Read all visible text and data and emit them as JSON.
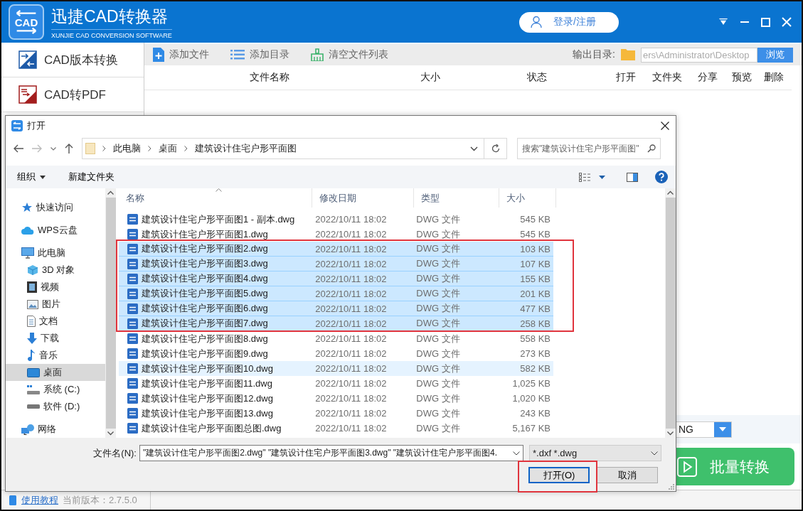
{
  "app": {
    "logo_text": "CAD",
    "title": "迅捷CAD转换器",
    "subtitle": "XUNJIE CAD CONVERSION SOFTWARE",
    "login": "登录/注册"
  },
  "sidebar": {
    "items": [
      {
        "label": "CAD版本转换",
        "kind": "version"
      },
      {
        "label": "CAD转PDF",
        "kind": "pdf"
      }
    ]
  },
  "toolbar": {
    "buttons": [
      {
        "label": "添加文件",
        "kind": "add-file"
      },
      {
        "label": "添加目录",
        "kind": "add-folder"
      },
      {
        "label": "清空文件列表",
        "kind": "clear"
      }
    ],
    "output_label": "输出目录:",
    "output_path": "ers\\Administrator\\Desktop",
    "browse": "浏览"
  },
  "table": {
    "columns": [
      "文件名称",
      "大小",
      "状态",
      "打开",
      "文件夹",
      "分享",
      "预览",
      "删除"
    ]
  },
  "format_select": {
    "value": "NG"
  },
  "convert_button": "批量转换",
  "status_bar": {
    "help_link": "使用教程",
    "version": "当前版本：2.7.5.0"
  },
  "dialog": {
    "title": "打开",
    "breadcrumb": [
      "此电脑",
      "桌面",
      "建筑设计住宅户形平面图"
    ],
    "search": {
      "placeholder": "搜索\"建筑设计住宅户形平面图\""
    },
    "commands": [
      "组织",
      "新建文件夹"
    ],
    "nav": [
      {
        "label": "快速访问",
        "kind": "star",
        "selected": false
      },
      {
        "label": "WPS云盘",
        "kind": "cloud",
        "selected": false
      },
      {
        "label": "此电脑",
        "kind": "pc",
        "selected": false,
        "children": [
          {
            "label": "3D 对象",
            "kind": "cube",
            "selected": false
          },
          {
            "label": "视频",
            "kind": "film",
            "selected": false
          },
          {
            "label": "图片",
            "kind": "image",
            "selected": false
          },
          {
            "label": "文档",
            "kind": "doc",
            "selected": false
          },
          {
            "label": "下载",
            "kind": "download",
            "selected": false
          },
          {
            "label": "音乐",
            "kind": "music",
            "selected": false
          },
          {
            "label": "桌面",
            "kind": "desktop",
            "selected": true
          },
          {
            "label": "系统 (C:)",
            "kind": "system-drive",
            "selected": false
          },
          {
            "label": "软件 (D:)",
            "kind": "drive",
            "selected": false
          }
        ]
      },
      {
        "label": "网络",
        "kind": "network",
        "selected": false
      }
    ],
    "columns": [
      "名称",
      "修改日期",
      "类型",
      "大小"
    ],
    "rows": [
      {
        "name": "建筑设计住宅户形平面图1 - 副本.dwg",
        "date": "2022/10/11 18:02",
        "type": "DWG 文件",
        "size": "545 KB",
        "selected": false,
        "hovered": false
      },
      {
        "name": "建筑设计住宅户形平面图1.dwg",
        "date": "2022/10/11 18:02",
        "type": "DWG 文件",
        "size": "545 KB",
        "selected": false,
        "hovered": false
      },
      {
        "name": "建筑设计住宅户形平面图2.dwg",
        "date": "2022/10/11 18:02",
        "type": "DWG 文件",
        "size": "103 KB",
        "selected": true,
        "hovered": false
      },
      {
        "name": "建筑设计住宅户形平面图3.dwg",
        "date": "2022/10/11 18:02",
        "type": "DWG 文件",
        "size": "107 KB",
        "selected": true,
        "hovered": false
      },
      {
        "name": "建筑设计住宅户形平面图4.dwg",
        "date": "2022/10/11 18:02",
        "type": "DWG 文件",
        "size": "155 KB",
        "selected": true,
        "hovered": false
      },
      {
        "name": "建筑设计住宅户形平面图5.dwg",
        "date": "2022/10/11 18:02",
        "type": "DWG 文件",
        "size": "201 KB",
        "selected": true,
        "hovered": false
      },
      {
        "name": "建筑设计住宅户形平面图6.dwg",
        "date": "2022/10/11 18:02",
        "type": "DWG 文件",
        "size": "477 KB",
        "selected": true,
        "hovered": false
      },
      {
        "name": "建筑设计住宅户形平面图7.dwg",
        "date": "2022/10/11 18:02",
        "type": "DWG 文件",
        "size": "258 KB",
        "selected": true,
        "hovered": false
      },
      {
        "name": "建筑设计住宅户形平面图8.dwg",
        "date": "2022/10/11 18:02",
        "type": "DWG 文件",
        "size": "558 KB",
        "selected": false,
        "hovered": false
      },
      {
        "name": "建筑设计住宅户形平面图9.dwg",
        "date": "2022/10/11 18:02",
        "type": "DWG 文件",
        "size": "273 KB",
        "selected": false,
        "hovered": false
      },
      {
        "name": "建筑设计住宅户形平面图10.dwg",
        "date": "2022/10/11 18:02",
        "type": "DWG 文件",
        "size": "582 KB",
        "selected": false,
        "hovered": true
      },
      {
        "name": "建筑设计住宅户形平面图11.dwg",
        "date": "2022/10/11 18:02",
        "type": "DWG 文件",
        "size": "1,025 KB",
        "selected": false,
        "hovered": false
      },
      {
        "name": "建筑设计住宅户形平面图12.dwg",
        "date": "2022/10/11 18:02",
        "type": "DWG 文件",
        "size": "1,020 KB",
        "selected": false,
        "hovered": false
      },
      {
        "name": "建筑设计住宅户形平面图13.dwg",
        "date": "2022/10/11 18:02",
        "type": "DWG 文件",
        "size": "243 KB",
        "selected": false,
        "hovered": false
      },
      {
        "name": "建筑设计住宅户形平面图总图.dwg",
        "date": "2022/10/11 18:02",
        "type": "DWG 文件",
        "size": "5,167 KB",
        "selected": false,
        "hovered": false
      }
    ],
    "filename_label": "文件名(N):",
    "filename": "\"建筑设计住宅户形平面图2.dwg\" \"建筑设计住宅户形平面图3.dwg\" \"建筑设计住宅户形平面图4.",
    "filter": "*.dxf *.dwg",
    "buttons": [
      {
        "label": "打开(O)",
        "kind": "primary"
      },
      {
        "label": "取消",
        "kind": "normal"
      }
    ]
  }
}
